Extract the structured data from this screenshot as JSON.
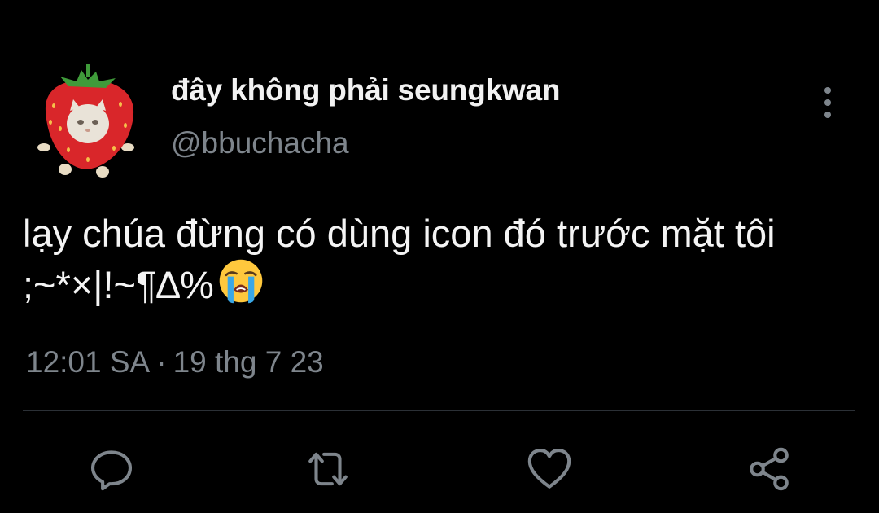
{
  "tweet": {
    "display_name": "đây không phải seungkwan",
    "handle": "@bbuchacha",
    "text": "lạy chúa đừng có dùng icon đó trước mặt tôi ;~*×|!~¶∆%",
    "emoji": "loudly-crying-face",
    "time": "12:01 SA",
    "separator": "·",
    "date": "19 thg 7 23"
  },
  "icons": {
    "avatar": "strawberry-cat-avatar",
    "more": "more-vertical-icon",
    "reply": "reply-icon",
    "retweet": "retweet-icon",
    "like": "heart-icon",
    "share": "share-icon"
  },
  "colors": {
    "background": "#000000",
    "text": "#f4f4f4",
    "muted": "#7e858c",
    "divider": "#2b3036",
    "strawberry": "#d9262a"
  }
}
